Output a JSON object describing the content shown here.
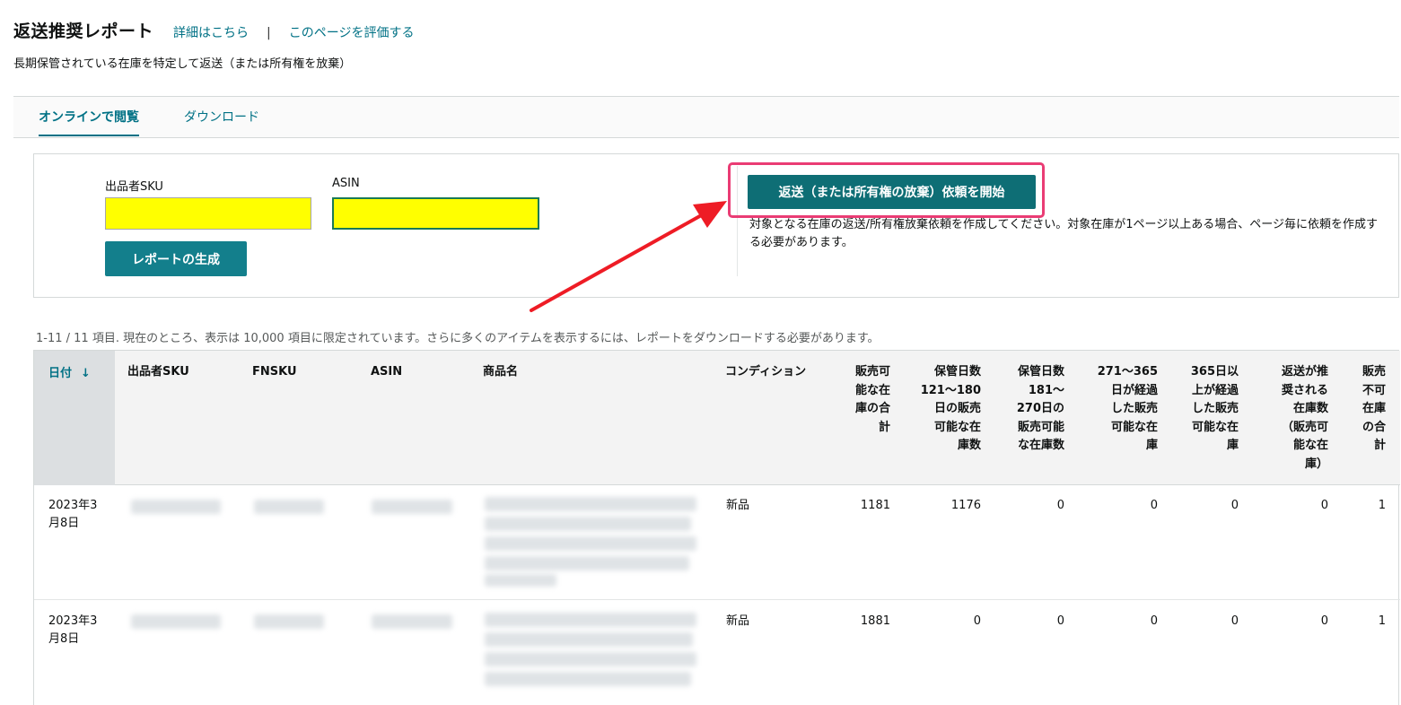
{
  "header": {
    "title": "返送推奨レポート",
    "details_link": "詳細はこちら",
    "separator": "|",
    "rate_link": "このページを評価する",
    "subtitle": "長期保管されている在庫を特定して返送（または所有権を放棄）"
  },
  "tabs": [
    {
      "label": "オンラインで閲覧",
      "active": true
    },
    {
      "label": "ダウンロード",
      "active": false
    }
  ],
  "filters": {
    "sku_label": "出品者SKU",
    "sku_value": "",
    "asin_label": "ASIN",
    "asin_value": "",
    "generate_button": "レポートの生成"
  },
  "removal": {
    "button": "返送（または所有権の放棄）依頼を開始",
    "note": "対象となる在庫の返送/所有権放棄依頼を作成してください。対象在庫が1ページ以上ある場合、ページ毎に依頼を作成する必要があります。"
  },
  "result_count": "1-11 / 11 項目. 現在のところ、表示は 10,000 項目に限定されています。さらに多くのアイテムを表示するには、レポートをダウンロードする必要があります。",
  "table": {
    "columns": {
      "date": "日付",
      "sku": "出品者SKU",
      "fnsku": "FNSKU",
      "asin": "ASIN",
      "product": "商品名",
      "condition": "コンディション",
      "sellable_total": "販売可\n能な在\n庫の合\n計",
      "days_121_180": "保管日数\n121～180\n日の販売\n可能な在\n庫数",
      "days_181_270": "保管日数\n181～\n270日の\n販売可能\nな在庫数",
      "days_271_365": "271～365\n日が経過\nした販売\n可能な在\n庫",
      "days_365_plus": "365日以\n上が経過\nした販売\n可能な在\n庫",
      "recommended": "返送が推\n奨される\n在庫数\n（販売可\n能な在\n庫）",
      "unsellable_total": "販売\n不可\n在庫\nの合\n計"
    },
    "rows": [
      {
        "date": "2023年3\n月8日",
        "condition": "新品",
        "sellable_total": "1181",
        "days_121_180": "1176",
        "days_181_270": "0",
        "days_271_365": "0",
        "days_365_plus": "0",
        "recommended": "0",
        "unsellable_total": "1"
      },
      {
        "date": "2023年3\n月8日",
        "condition": "新品",
        "sellable_total": "1881",
        "days_121_180": "0",
        "days_181_270": "0",
        "days_271_365": "0",
        "days_365_plus": "0",
        "recommended": "0",
        "unsellable_total": "1"
      }
    ]
  },
  "icons": {
    "sort": "arrow-down-icon"
  },
  "colors": {
    "accent": "#007185",
    "button": "#137f8c",
    "highlight_input": "#ffff00",
    "annotation": "#ea3c74",
    "arrow": "#ee1c25"
  }
}
